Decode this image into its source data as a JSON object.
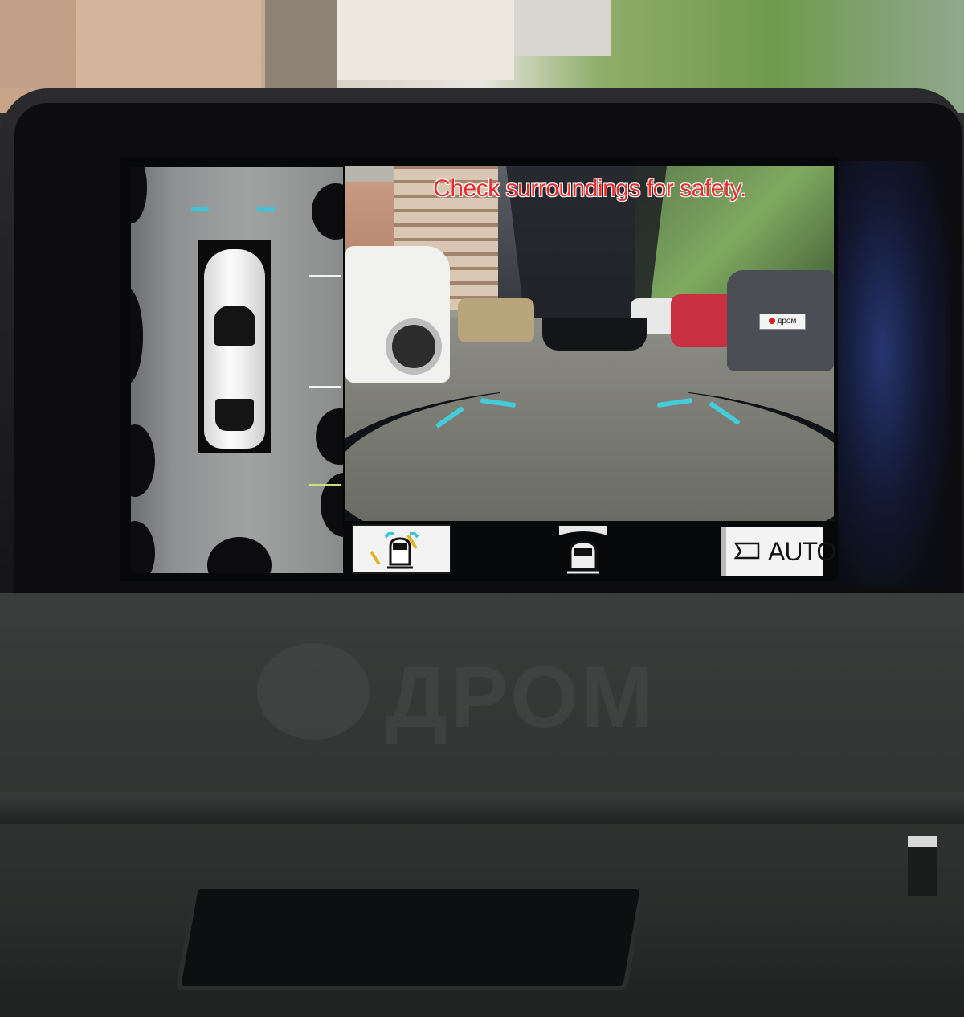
{
  "screen": {
    "warning_text": "Check surroundings for safety.",
    "camera_mode_label": "AUTO",
    "plate_text": "дром",
    "watermark_text": "ДРОМ"
  },
  "buttons": {
    "view_select_icon": "car-top-view-with-guides-icon",
    "wide_view_icon": "car-wide-view-icon",
    "auto_icon": "camera-frame-icon"
  },
  "colors": {
    "warning": "#e62b2b",
    "guide_lines": "#3fd4e6",
    "selected_button_bg": "#f3f3f3"
  }
}
